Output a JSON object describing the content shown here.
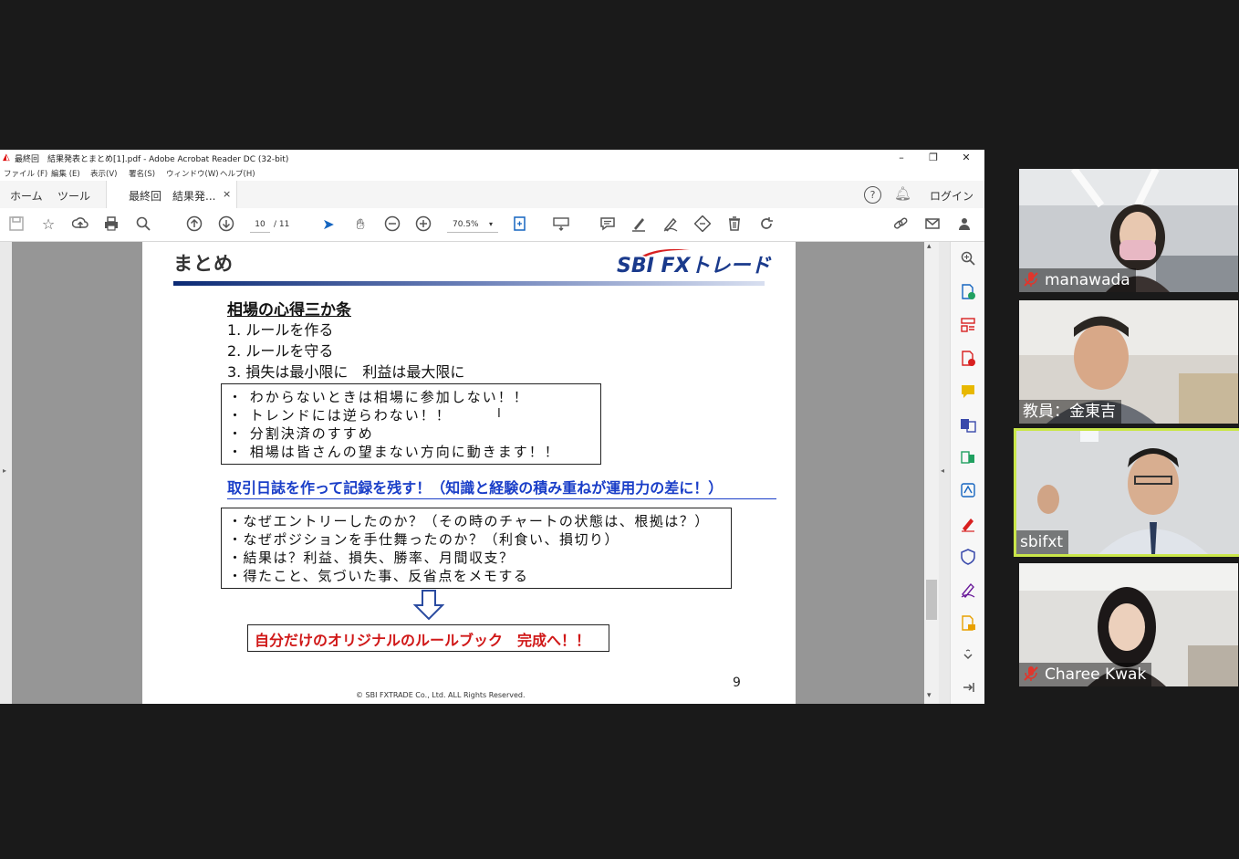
{
  "window": {
    "title": "最終回　結果発表とまとめ[1].pdf - Adobe Acrobat Reader DC (32-bit)",
    "menu": [
      "ファイル (F)",
      "編集 (E)",
      "表示(V)",
      "署名(S)",
      "ウィンドウ(W)",
      "ヘルプ(H)"
    ]
  },
  "tabs": {
    "home": "ホーム",
    "tools": "ツール",
    "document": "最終回　結果発...",
    "close": "×",
    "login": "ログイン"
  },
  "toolbar": {
    "page_current": "10",
    "page_total": "/ 11",
    "zoom": "70.5%"
  },
  "slide": {
    "title": "まとめ",
    "logo": "SBI FXトレード",
    "rules_heading": "相場の心得三か条",
    "rules": [
      "1. ルールを作る",
      "2. ルールを守る",
      "3. 損失は最小限に　利益は最大限に"
    ],
    "bullets": [
      "・ わからないときは相場に参加しない！！",
      "・ トレンドには逆らわない！！",
      "・ 分割決済のすすめ",
      "・ 相場は皆さんの望まない方向に動きます！！"
    ],
    "blue_heading": "取引日誌を作って記録を残す！（知識と経験の積み重ねが運用力の差に！）",
    "questions": [
      "・なぜエントリーしたのか？（その時のチャートの状態は、根拠は？）",
      "・なぜポジションを手仕舞ったのか？（利食い、損切り）",
      "・結果は？利益、損失、勝率、月間収支？",
      "・得たこと、気づいた事、反省点をメモする"
    ],
    "conclusion": "自分だけのオリジナルのルールブック　完成へ！！",
    "page_number": "9",
    "copyright": "© SBI FXTRADE Co., Ltd. ALL Rights Reserved."
  },
  "participants": [
    {
      "name": "manawada",
      "muted": true
    },
    {
      "name": "教員：金東吉",
      "muted": false
    },
    {
      "name": "sbifxt",
      "muted": false,
      "active_speaker": true
    },
    {
      "name": "Charee Kwak",
      "muted": true
    }
  ],
  "colors": {
    "accent_blue": "#1a3ec8",
    "conclusion_red": "#d01818",
    "active_speaker_border": "#c9e64a",
    "mute_red": "#e0362c"
  }
}
